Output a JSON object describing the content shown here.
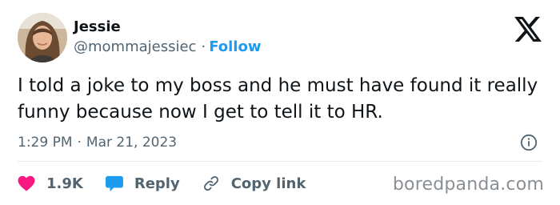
{
  "author": {
    "name": "Jessie",
    "handle": "@mommajessiec",
    "separator": "·",
    "follow_label": "Follow"
  },
  "tweet": {
    "text": "I told a joke to my boss and he must have found it really funny because now I get to tell it to HR.",
    "time": "1:29 PM",
    "date_separator": "·",
    "date": "Mar 21, 2023"
  },
  "actions": {
    "like_count": "1.9K",
    "reply_label": "Reply",
    "copy_link_label": "Copy link"
  },
  "watermark": "boredpanda.com",
  "colors": {
    "accent": "#1d9bf0",
    "like": "#f91880",
    "text": "#0f1419",
    "muted": "#536471"
  },
  "icons": {
    "logo": "x-logo-icon",
    "info": "info-icon",
    "like": "heart-icon",
    "reply": "speech-bubble-icon",
    "copy_link": "link-icon"
  }
}
